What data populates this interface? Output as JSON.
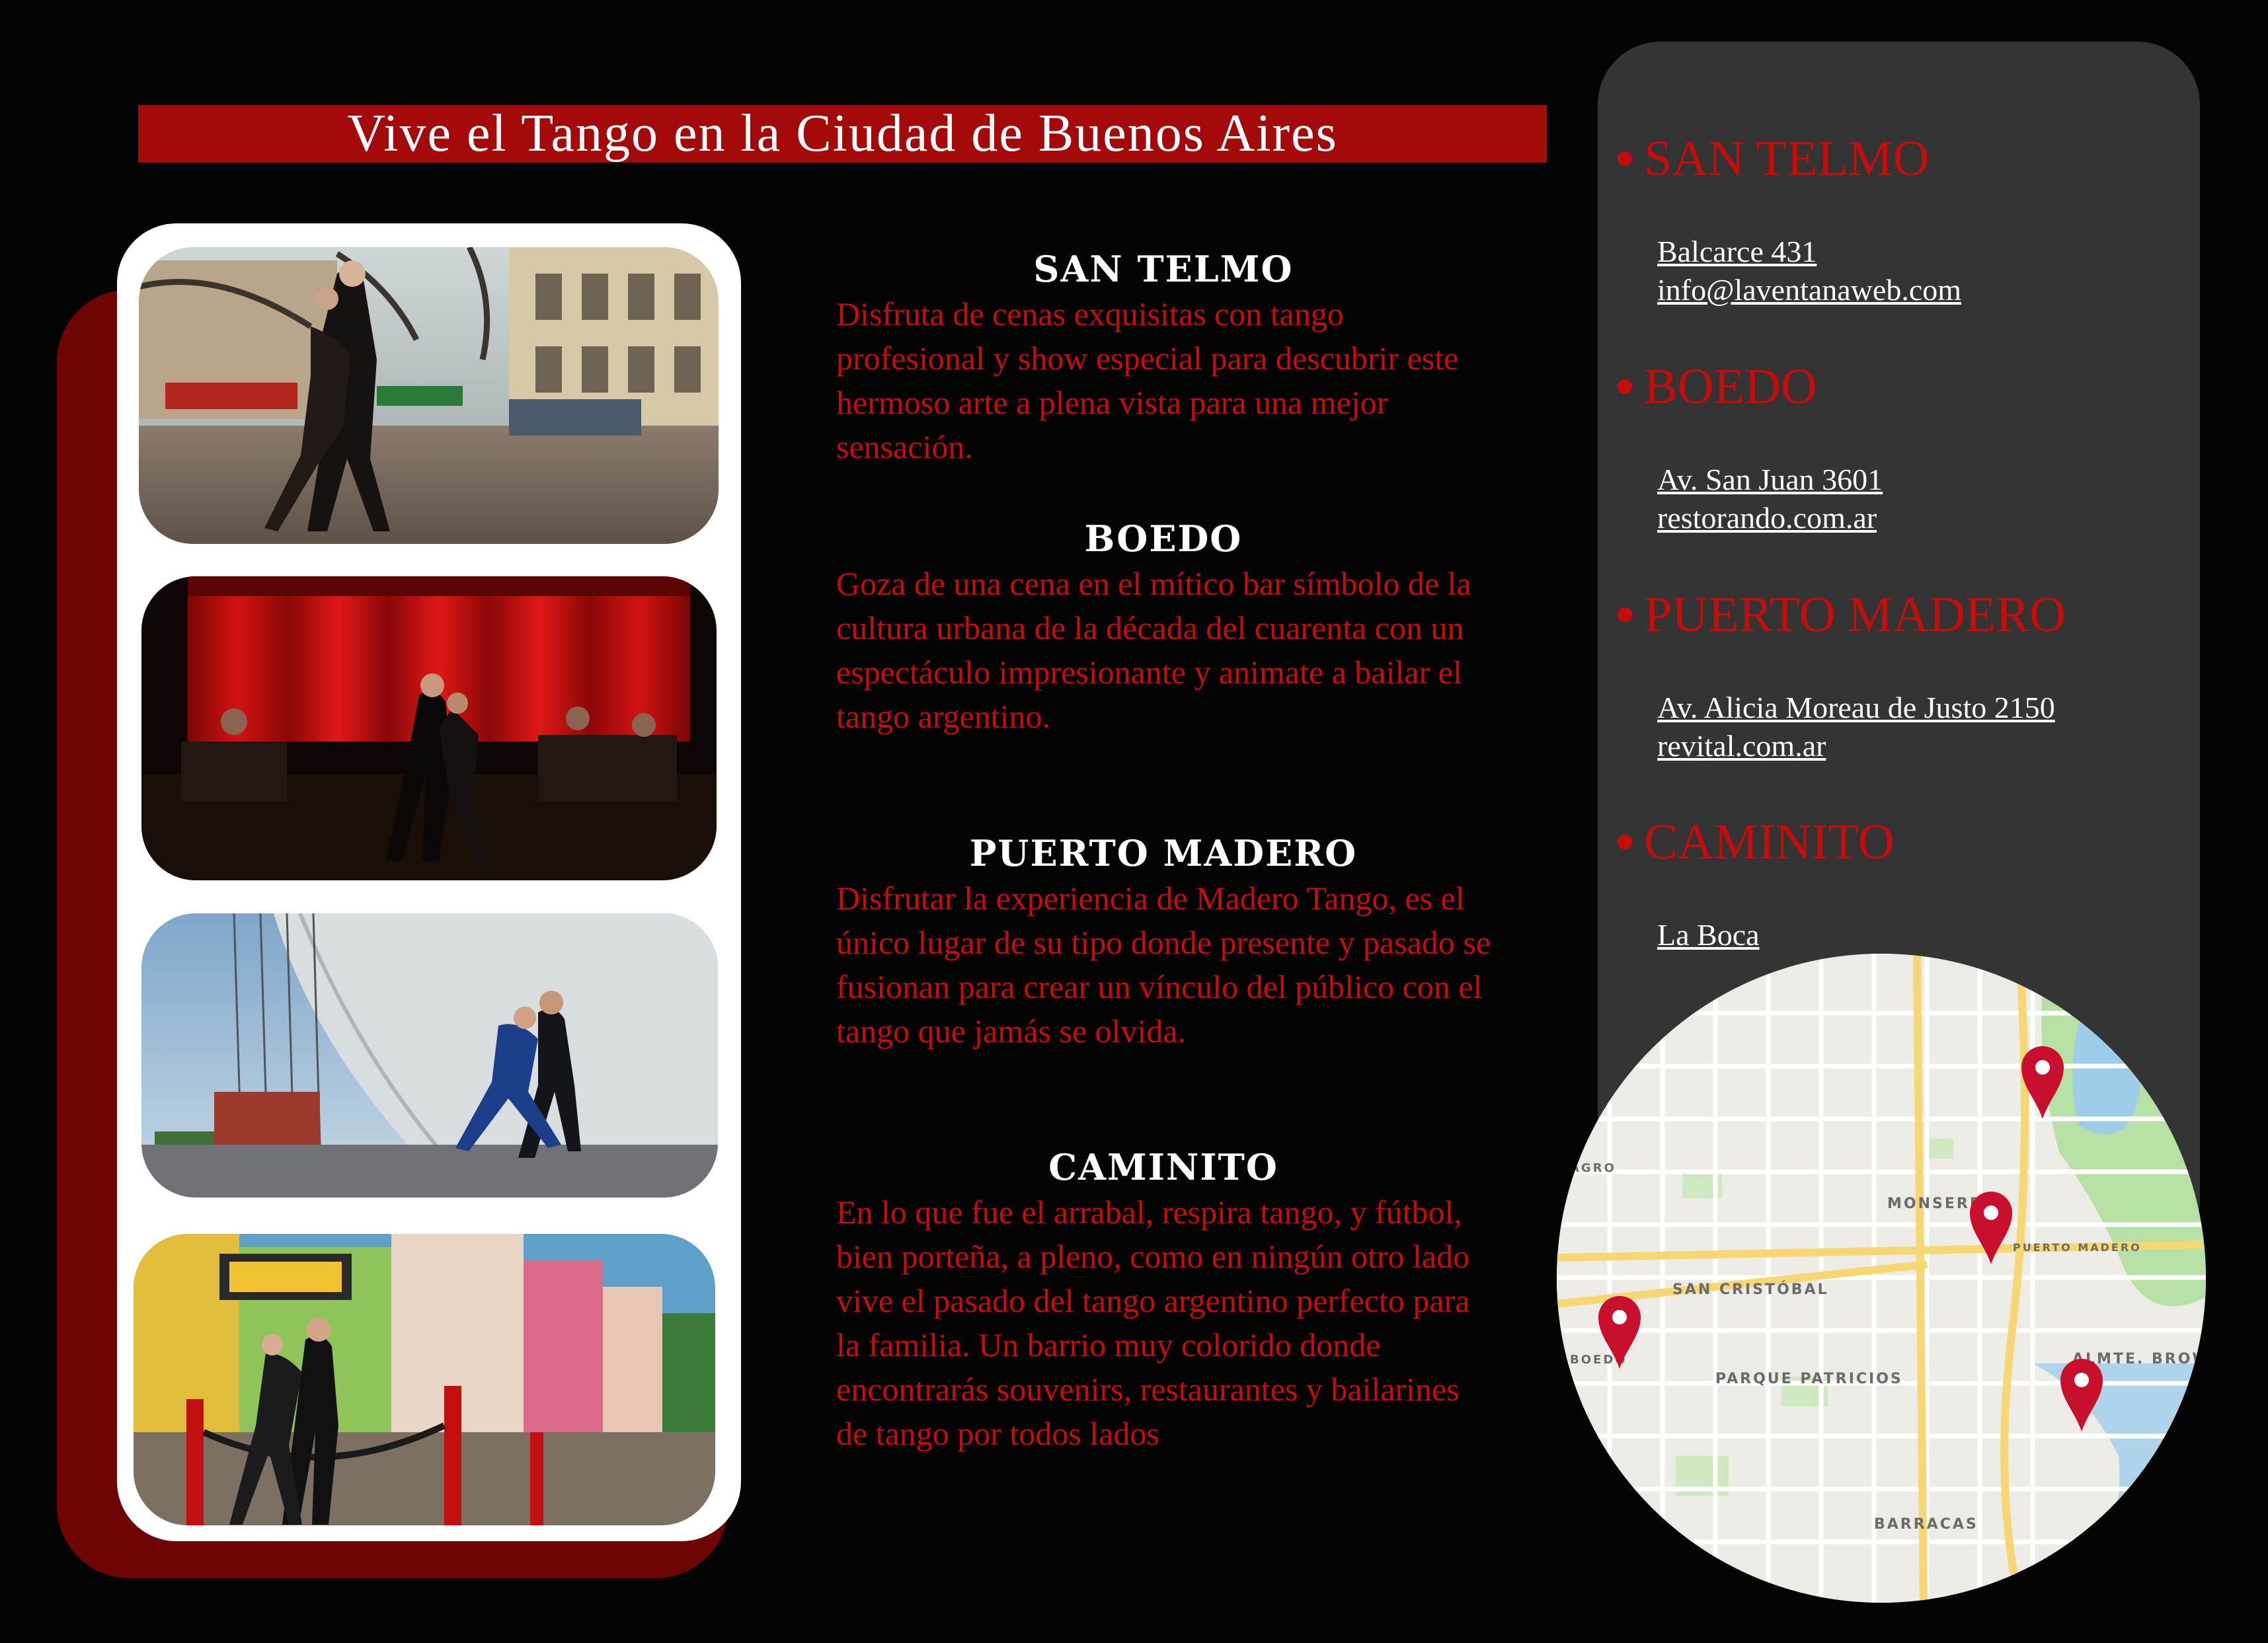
{
  "title": "Vive el Tango en la Ciudad de Buenos Aires",
  "sections": [
    {
      "heading": "SAN TELMO",
      "text": "Disfruta de cenas exquisitas con tango profesional y show especial para descubrir este hermoso arte a plena vista para una mejor sensación."
    },
    {
      "heading": "BOEDO",
      "text": "Goza de una cena en el mítico bar símbolo de la cultura urbana de la década del cuarenta con un espectáculo impresionante y animate a bailar el tango argentino."
    },
    {
      "heading": "PUERTO MADERO",
      "text": "Disfrutar la experiencia  de Madero Tango, es el único lugar de su tipo donde presente y pasado se fusionan para crear un vínculo del público con el tango que jamás se olvida."
    },
    {
      "heading": "CAMINITO",
      "text": "En lo que fue el arrabal, respira tango, y fútbol, bien porteña, a pleno, como en ningún otro lado vive el pasado del tango argentino perfecto para la familia. Un barrio muy colorido donde encontrarás souvenirs, restaurantes y bailarines de tango por todos lados"
    }
  ],
  "locations": [
    {
      "name": "SAN TELMO",
      "lines": [
        "Balcarce 431",
        "info@laventanaweb.com"
      ]
    },
    {
      "name": "BOEDO",
      "lines": [
        "Av. San Juan 3601",
        "restorando.com.ar"
      ]
    },
    {
      "name": "PUERTO MADERO",
      "lines": [
        "Av. Alicia Moreau de Justo 2150",
        "revital.com.ar"
      ]
    },
    {
      "name": "CAMINITO",
      "lines": [
        "La Boca"
      ]
    }
  ],
  "map": {
    "labels": [
      "MONSERRAT",
      "SAN CRISTÓBAL",
      "PARQUE PATRICIOS",
      "BARRACAS",
      "ALMTE. BROWN",
      "PUERTO MADERO",
      "BOEDO",
      "AGRO"
    ],
    "pin_color": "#c8102e"
  },
  "colors": {
    "background": "#040404",
    "title_bar": "#a50a0a",
    "accent_red": "#c70c0c",
    "panel": "#343434"
  }
}
